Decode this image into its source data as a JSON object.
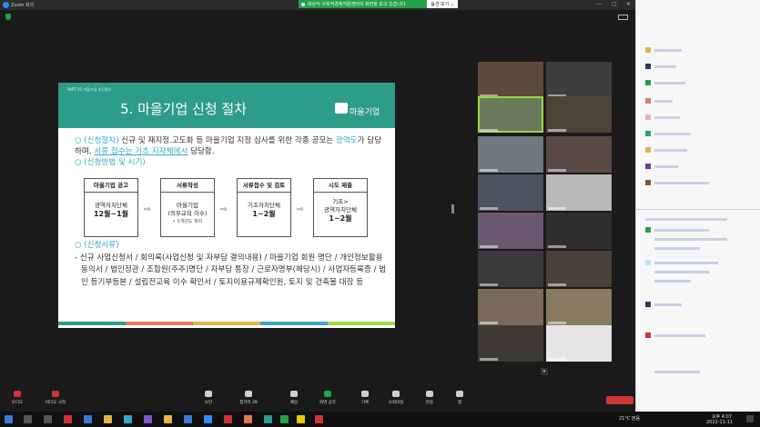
{
  "window": {
    "title": "Zoom 회의"
  },
  "share_banner": {
    "message": "화상식 사회적경제지원센터의 화면을 보고 있습니다",
    "options": "옵션 보기 ⌄"
  },
  "slide": {
    "part_label": "PART 01 마을기업 추진절차",
    "title": "5. 마을기업 신청 절차",
    "logo_text": "마을기업",
    "p1_marker": "○ (신청절차)",
    "p1_text1": " 신규 및 재지정.고도화 등 마을기업 지정 심사를 위한 각종 공모는 ",
    "p1_hl": "광역도",
    "p1_text2": "가 담당하며, ",
    "p1_ul": "서류 접수는 기초 지자체에서",
    "p1_text3": " 담당함.",
    "p2": "○ (신청방법 및 시기)",
    "steps": [
      {
        "head": "마을기업 공고",
        "line1": "광역자치단체",
        "line2": "12월~1월",
        "small": ""
      },
      {
        "head": "서류작성",
        "line1": "마을기업",
        "line2": "(의무교육 이수)",
        "small": "• 3개년도 제외"
      },
      {
        "head": "서류접수 및 검토",
        "line1": "기초자치단체",
        "line2": "1~2월",
        "small": ""
      },
      {
        "head": "시도 제출",
        "line1": "기초>",
        "line2": "광역자치단체",
        "line3": "1~2월"
      }
    ],
    "arrow": "⇨",
    "p3": "○ (신청서류)",
    "docs": "- 신규 사업신청서 / 회의록(사업신청 및 자부담 결의내용) / 마을기업 회원 명단 / 개인정보활용 동의서 / 법인정관 / 조합원(주주)명단 / 자부담 통장 / 근로자명부(해당시) / 사업자등록증 / 법인 등기부등본 / 설립전교육 이수 확인서 / 토지이용규제확인원, 토지 및 건축물 대장 등",
    "footer_colors": [
      "#2d9c88",
      "#e07a5f",
      "#e8b04a",
      "#3aa7c7",
      "#9ad846"
    ]
  },
  "gallery": {
    "pager": "▾"
  },
  "toolbar": {
    "audio": "오디오",
    "video": "비디오 시작",
    "security": "보안",
    "participants": "참가자",
    "participants_count": "29",
    "chat": "채팅",
    "share": "화면 공유",
    "record": "기록",
    "reactions": "소회의실",
    "apps": "반응",
    "more": "앱"
  },
  "taskbar": {
    "weather": "21°C 맑음",
    "time": "오후 4:07",
    "date": "2022-11-11"
  },
  "colors": {
    "zoom_blue": "#2d8cff",
    "green": "#24a148",
    "slide_teal": "#2d9c88",
    "accent": "#3aa7c7"
  }
}
